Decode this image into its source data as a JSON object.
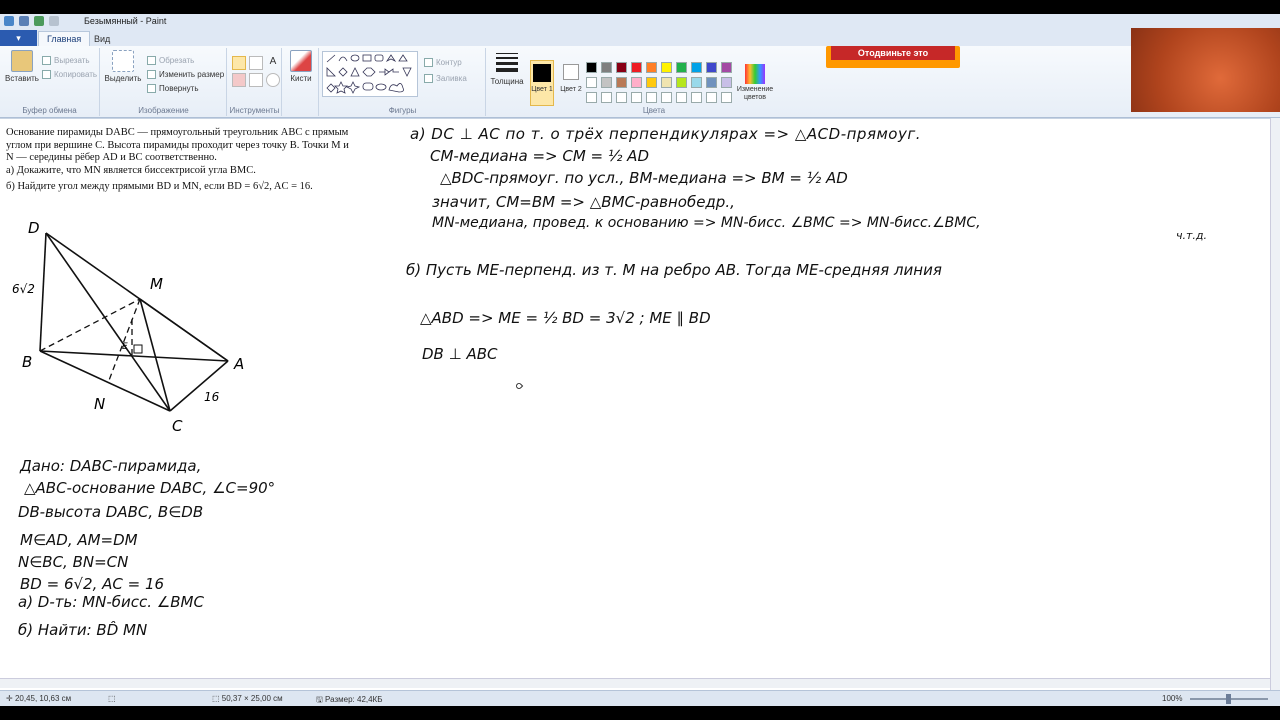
{
  "window": {
    "title": "Безымянный - Paint"
  },
  "tabs": {
    "file": "▾",
    "home": "Главная",
    "view": "Вид"
  },
  "clipboard": {
    "paste": "Вставить",
    "cut": "Вырезать",
    "copy": "Копировать",
    "label": "Буфер обмена"
  },
  "image": {
    "select": "Выделить",
    "crop": "Обрезать",
    "resize": "Изменить размер",
    "rotate": "Повернуть",
    "label": "Изображение"
  },
  "tools": {
    "label": "Инструменты"
  },
  "brushes": {
    "label": "Кисти"
  },
  "shapes": {
    "outline": "Контур",
    "fill": "Заливка",
    "label": "Фигуры"
  },
  "size": {
    "label": "Толщина"
  },
  "colors": {
    "color1": "Цвет 1",
    "color2": "Цвет 2",
    "edit": "Изменение цветов",
    "label": "Цвета",
    "palette": [
      "#000000",
      "#7f7f7f",
      "#880015",
      "#ed1c24",
      "#ff7f27",
      "#fff200",
      "#22b14c",
      "#00a2e8",
      "#3f48cc",
      "#a349a4",
      "#ffffff",
      "#c3c3c3",
      "#b97a57",
      "#ffaec9",
      "#ffc90e",
      "#efe4b0",
      "#b5e61d",
      "#99d9ea",
      "#7092be",
      "#c8bfe7"
    ]
  },
  "banner": {
    "text": "Отодвиньте это"
  },
  "problem": {
    "line1": "Основание пирамиды DABC — прямоугольный треугольник ABC с прямым",
    "line2": "углом при вершине C. Высота пирамиды проходит через точку B. Точки M и",
    "line3": "N — середины рёбер AD и BC соответственно.",
    "line4": "а) Докажите, что MN является биссектрисой угла BMC.",
    "line5": "б) Найдите угол между прямыми BD и MN, если BD = 6√2, AC = 16."
  },
  "figure": {
    "labels": {
      "D": "D",
      "M": "M",
      "B": "B",
      "A": "A",
      "N": "N",
      "C": "C",
      "E": "E",
      "bd": "6√2",
      "ac": "16"
    }
  },
  "given": {
    "l1": "Дано: DABC-пирамида,",
    "l2": "△ABC-основание DABC, ∠C=90°",
    "l3": "DB-высота DABC, B∈DB",
    "l4": "M∈AD, AM=DM",
    "l5": "N∈BC, BN=CN",
    "l6": "BD = 6√2, AC = 16",
    "l7": "а) D-ть: MN-бисс. ∠BMC",
    "l8": "б) Найти: BD̂ MN"
  },
  "solution": {
    "a1": "а) DC ⊥ AC по т. о трёх перпендикулярах => △ACD-прямоуг.",
    "a2": "CM-медиана => CM = ½ AD",
    "a3": "△BDC-прямоуг. по усл., BM-медиана => BM = ½ AD",
    "a4": "значит, CM=BM => △BMC-равнобедр.,",
    "a5": "MN-медиана, провед. к основанию => MN-бисс. ∠BMC => MN-бисс.∠BMC,",
    "a6": "ч.т.д.",
    "b1": "б) Пусть ME-перпенд. из т. M на ребро AB. Тогда ME-средняя линия",
    "b2": "△ABD => ME = ½ BD = 3√2 ;   ME ∥ BD",
    "b3": "DB ⊥ ABC"
  },
  "status": {
    "cursor": "20,45, 10,63 см",
    "selection": "50,37 × 25,00 см",
    "filesize": "Размер: 42,4КБ",
    "zoom": "100%"
  }
}
